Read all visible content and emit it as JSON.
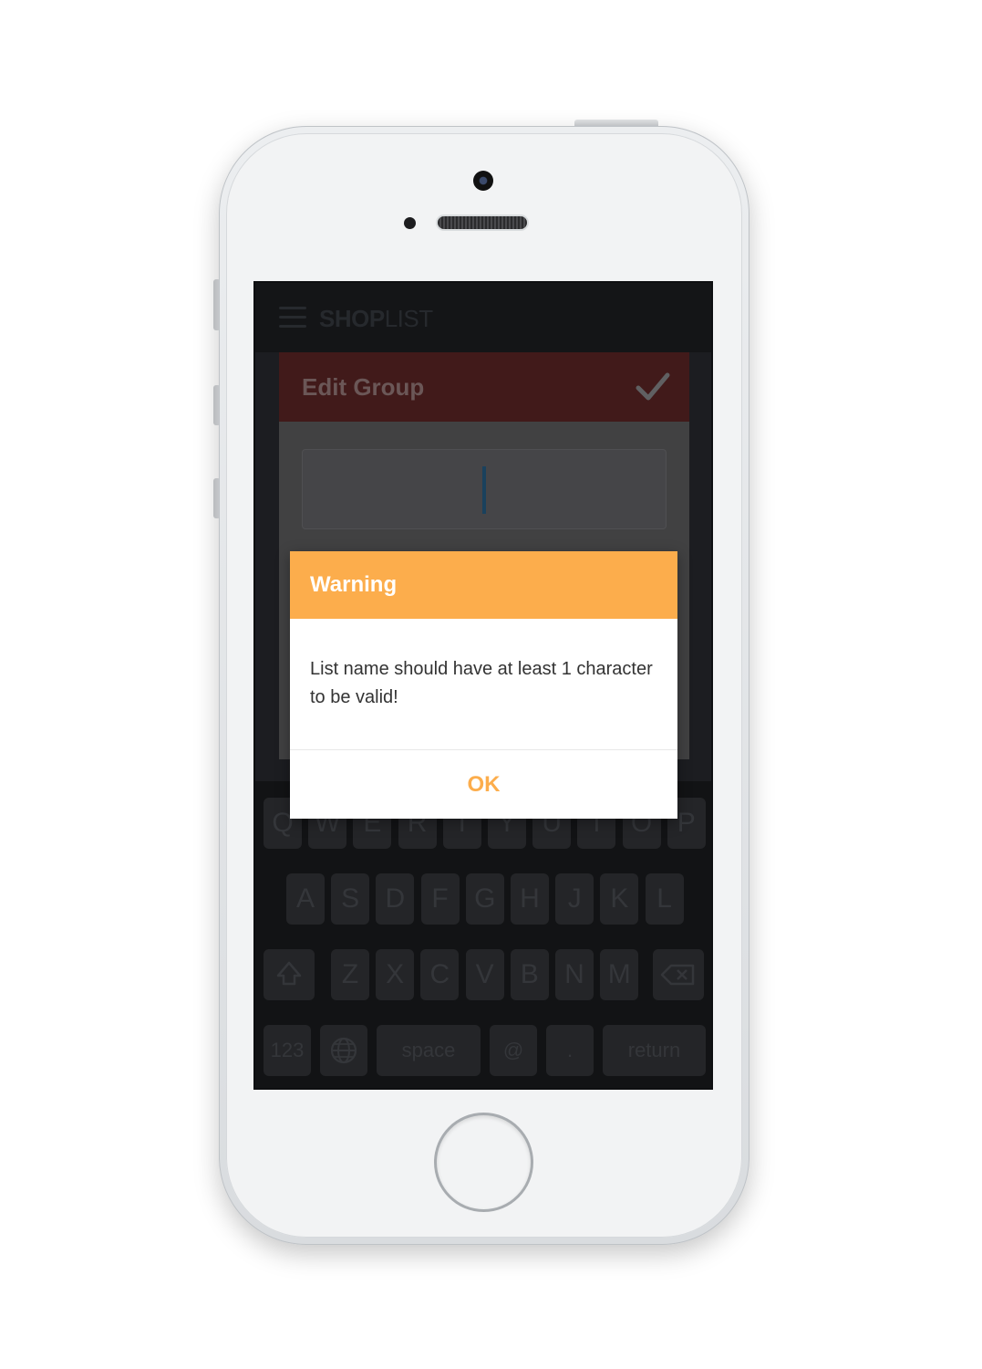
{
  "app": {
    "brand_bold": "SHOP",
    "brand_light": "LIST"
  },
  "edit_group": {
    "title": "Edit Group",
    "name_value": ""
  },
  "dialog": {
    "title": "Warning",
    "message": "List name should have at least 1 character to be valid!",
    "ok_label": "OK"
  },
  "keyboard": {
    "row1": [
      "Q",
      "W",
      "E",
      "R",
      "T",
      "Y",
      "U",
      "I",
      "O",
      "P"
    ],
    "row2": [
      "A",
      "S",
      "D",
      "F",
      "G",
      "H",
      "J",
      "K",
      "L"
    ],
    "row3": [
      "Z",
      "X",
      "C",
      "V",
      "B",
      "N",
      "M"
    ],
    "numbers_label": "123",
    "space_label": "space",
    "at_label": "@",
    "dot_label": ".",
    "return_label": "return"
  },
  "colors": {
    "accent": "#fcad4c",
    "header_dark_red": "#4a1e1e",
    "screen_bg": "#202226"
  },
  "icons": [
    "hamburger-icon",
    "check-icon",
    "shift-icon",
    "backspace-icon",
    "globe-icon"
  ]
}
